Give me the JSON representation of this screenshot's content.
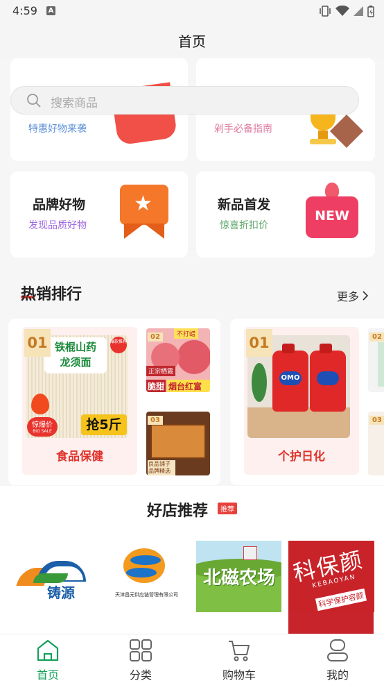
{
  "status": {
    "time": "4:59"
  },
  "header": {
    "title": "首页"
  },
  "search": {
    "placeholder": "搜索商品"
  },
  "promos": [
    {
      "title": "",
      "subtitle": "特惠好物来袭",
      "subtitle_color": "#5a8fd8"
    },
    {
      "title": "",
      "subtitle": "剁手必备指南",
      "subtitle_color": "#e07aa0"
    },
    {
      "title": "品牌好物",
      "subtitle": "发现品质好物",
      "subtitle_color": "#a06be0"
    },
    {
      "title": "新品首发",
      "subtitle": "惊喜折扣价",
      "subtitle_color": "#5fa66b"
    }
  ],
  "hot": {
    "title": "热销排行",
    "more": "更多",
    "cards": [
      {
        "rank": "01",
        "category": "食品保健",
        "main_product": {
          "name": "铁棍山药\n龙须面",
          "tag": "爆款推荐",
          "promo": "惊爆价",
          "promo_en": "BIG SALE",
          "qty": "抢5斤"
        },
        "small": [
          {
            "rank": "02",
            "top_tag": "不打蜡",
            "left_tag": "正宗栖霞",
            "caption_a": "脆甜",
            "caption_b": "烟台红富士"
          },
          {
            "rank": "03",
            "bottom_tag": "良品铺子 品牌精选"
          }
        ]
      },
      {
        "rank": "01",
        "category": "个护日化",
        "main_product": {
          "name": "OMO"
        },
        "small": [
          {
            "rank": "02"
          },
          {
            "rank": "03"
          }
        ]
      }
    ]
  },
  "shops": {
    "title": "好店推荐",
    "tag": "推荐",
    "items": [
      {
        "name": "铸源"
      },
      {
        "name": "天津昌元供应链管理有限公司"
      },
      {
        "name": "北磁农场"
      },
      {
        "name": "科保颜",
        "en": "KEBAOYAN",
        "slogan": "科学保护容颜"
      }
    ]
  },
  "tabbar": {
    "items": [
      {
        "label": "首页",
        "icon": "home-icon",
        "active": true
      },
      {
        "label": "分类",
        "icon": "grid-icon"
      },
      {
        "label": "购物车",
        "icon": "cart-icon"
      },
      {
        "label": "我的",
        "icon": "user-icon"
      }
    ]
  },
  "colors": {
    "accent": "#13a05a",
    "red": "#e0332c"
  }
}
